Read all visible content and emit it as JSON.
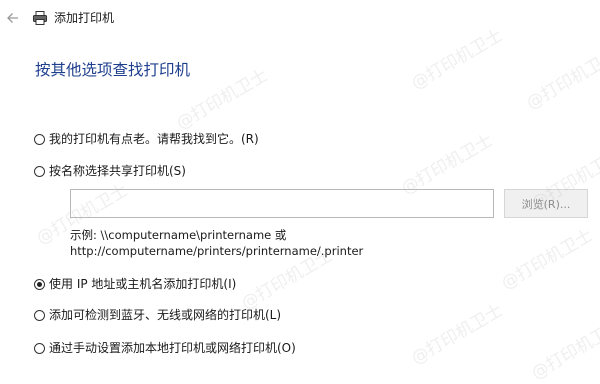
{
  "window": {
    "title": "添加打印机",
    "back_icon": "arrow-left-icon",
    "title_icon": "printer-icon"
  },
  "heading": "按其他选项查找打印机",
  "options": [
    {
      "label": "我的打印机有点老。请帮我找到它。(R)",
      "selected": false
    },
    {
      "label": "按名称选择共享打印机(S)",
      "selected": false
    },
    {
      "label": "使用 IP 地址或主机名添加打印机(I)",
      "selected": true
    },
    {
      "label": "添加可检测到蓝牙、无线或网络的打印机(L)",
      "selected": false
    },
    {
      "label": "通过手动设置添加本地打印机或网络打印机(O)",
      "selected": false
    }
  ],
  "share_input": {
    "value": ""
  },
  "browse_button": {
    "label": "浏览(R)...",
    "enabled": false
  },
  "example": {
    "line1": "示例: \\\\computername\\printername 或",
    "line2": "http://computername/printers/printername/.printer"
  },
  "watermark": "@打印机卫士",
  "colors": {
    "heading": "#1e3f8e",
    "disabled_text": "#8c8c8c"
  }
}
